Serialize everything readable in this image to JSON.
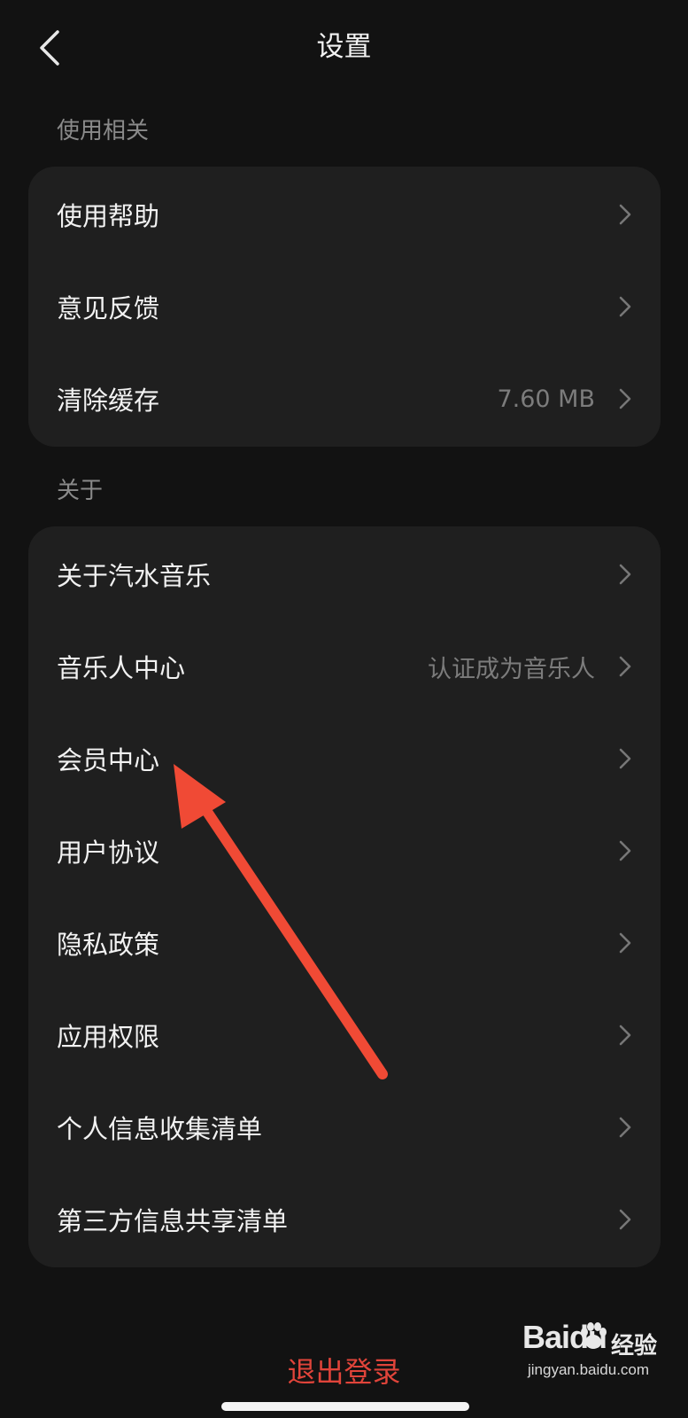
{
  "header": {
    "title": "设置",
    "back_icon": "chevron-left-icon"
  },
  "sections": [
    {
      "label": "使用相关",
      "items": [
        {
          "label": "使用帮助",
          "value": ""
        },
        {
          "label": "意见反馈",
          "value": ""
        },
        {
          "label": "清除缓存",
          "value": "7.60 MB"
        }
      ]
    },
    {
      "label": "关于",
      "items": [
        {
          "label": "关于汽水音乐",
          "value": ""
        },
        {
          "label": "音乐人中心",
          "value": "认证成为音乐人"
        },
        {
          "label": "会员中心",
          "value": ""
        },
        {
          "label": "用户协议",
          "value": ""
        },
        {
          "label": "隐私政策",
          "value": ""
        },
        {
          "label": "应用权限",
          "value": ""
        },
        {
          "label": "个人信息收集清单",
          "value": ""
        },
        {
          "label": "第三方信息共享清单",
          "value": ""
        }
      ]
    }
  ],
  "footer": {
    "logout_label": "退出登录"
  },
  "watermark": {
    "brand": "Baidu",
    "sub": "经验",
    "url": "jingyan.baidu.com"
  },
  "colors": {
    "background": "#121212",
    "card": "#1f1f1f",
    "accent_red": "#e0443a",
    "annotation_arrow": "#f04a35"
  }
}
